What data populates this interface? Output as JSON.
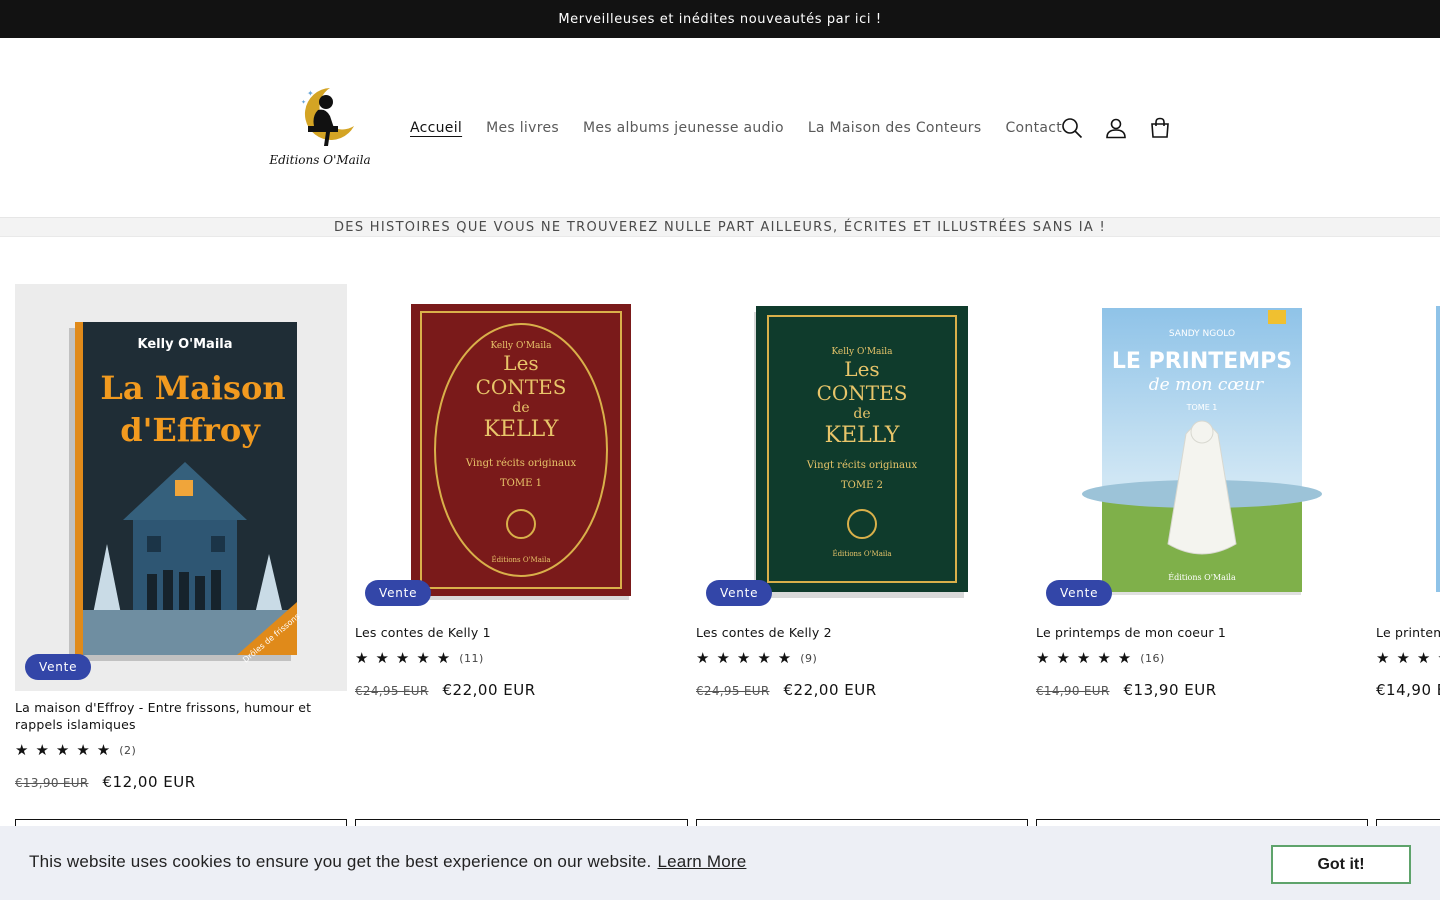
{
  "announcement": "Merveilleuses et inédites nouveautés par ici !",
  "brand": {
    "logo_text": "Editions O'Maila"
  },
  "nav": [
    {
      "label": "Accueil",
      "active": true
    },
    {
      "label": "Mes livres"
    },
    {
      "label": "Mes albums jeunesse audio"
    },
    {
      "label": "La Maison des Conteurs"
    },
    {
      "label": "Contact"
    }
  ],
  "header_icons": [
    "search-icon",
    "account-icon",
    "cart-icon"
  ],
  "tagline": "DES HISTOIRES QUE VOUS NE TROUVEREZ NULLE PART AILLEURS, ÉCRITES ET ILLUSTRÉES SANS IA !",
  "stars": "★★★★★",
  "products": [
    {
      "title": "La maison d'Effroy - Entre frissons, humour et rappels islamiques",
      "badge": "Vente",
      "rating_count": "(2)",
      "old_price": "€13,90 EUR",
      "new_price": "€12,00 EUR",
      "cover": {
        "author": "Kelly O'Maila",
        "title_1": "La Maison",
        "title_2": "d'Effroy",
        "sticker": "Drôles de frissons"
      }
    },
    {
      "title": "Les contes de Kelly 1",
      "badge": "Vente",
      "rating_count": "(11)",
      "old_price": "€24,95 EUR",
      "new_price": "€22,00 EUR",
      "cover": {
        "author": "Kelly O'Maila",
        "line_1": "Les",
        "line_2": "CONTES",
        "line_3": "de",
        "line_4": "KELLY",
        "subtitle": "Vingt récits originaux",
        "tome": "TOME 1",
        "publisher": "Éditions O'Maila"
      }
    },
    {
      "title": "Les contes de Kelly 2",
      "badge": "Vente",
      "rating_count": "(9)",
      "old_price": "€24,95 EUR",
      "new_price": "€22,00 EUR",
      "cover": {
        "author": "Kelly O'Maila",
        "line_1": "Les",
        "line_2": "CONTES",
        "line_3": "de",
        "line_4": "KELLY",
        "subtitle": "Vingt récits originaux",
        "tome": "TOME 2",
        "publisher": "Éditions O'Maila"
      }
    },
    {
      "title": "Le printemps de mon coeur 1",
      "badge": "Vente",
      "rating_count": "(16)",
      "old_price": "€14,90 EUR",
      "new_price": "€13,90 EUR",
      "cover": {
        "author": "SANDY NGOLO",
        "title_1": "LE PRINTEMPS",
        "title_2": "de mon cœur",
        "tome": "TOME 1",
        "publisher": "Éditions O'Maila"
      }
    },
    {
      "title": "Le printem",
      "new_price": "€14,90 EU"
    }
  ],
  "cookie": {
    "message": "This website uses cookies to ensure you get the best experience on our website.",
    "link": "Learn More",
    "button": "Got it!"
  }
}
